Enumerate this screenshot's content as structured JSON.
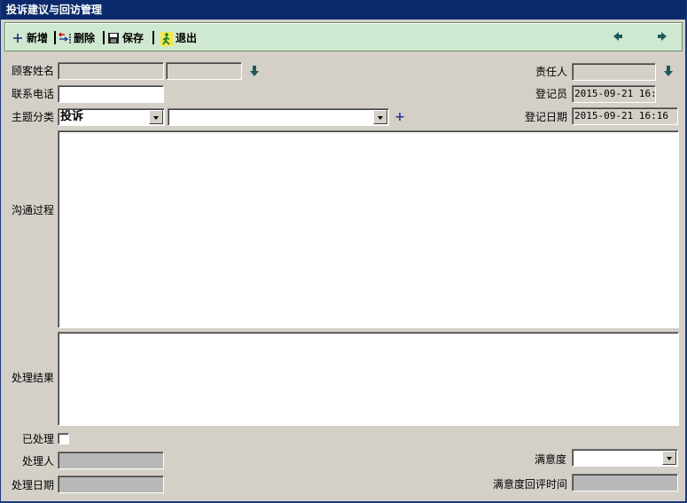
{
  "window": {
    "title": "投诉建议与回访管理"
  },
  "toolbar": {
    "new_label": "新增",
    "delete_label": "删除",
    "save_label": "保存",
    "exit_label": "退出",
    "icons": [
      "plus-icon",
      "delete-icon",
      "save-icon",
      "exit-icon",
      "prev-arrow-icon",
      "next-arrow-icon"
    ]
  },
  "form": {
    "customer_name": {
      "label": "顾客姓名",
      "value": "",
      "value2": ""
    },
    "phone": {
      "label": "联系电话",
      "value": ""
    },
    "category": {
      "label": "主题分类",
      "value": "投诉",
      "subvalue": ""
    },
    "responsible": {
      "label": "责任人",
      "value": ""
    },
    "registrar": {
      "label": "登记员",
      "value": "2015-09-21 16:1"
    },
    "register_date": {
      "label": "登记日期",
      "value": "2015-09-21 16:16"
    },
    "process": {
      "label": "沟通过程",
      "value": ""
    },
    "result": {
      "label": "处理结果",
      "value": ""
    },
    "processed": {
      "label": "已处理",
      "checked": false
    },
    "handler": {
      "label": "处理人",
      "value": ""
    },
    "handle_date": {
      "label": "处理日期",
      "value": ""
    },
    "satisfaction": {
      "label": "满意度",
      "value": ""
    },
    "satisfaction_review_time": {
      "label": "满意度回评时间",
      "value": ""
    }
  },
  "colors": {
    "titlebar": "#0a2a6b",
    "toolbar": "#cfe8d0",
    "window_bg": "#d4d0c8",
    "arrow_icon": "#1f5a5a"
  }
}
